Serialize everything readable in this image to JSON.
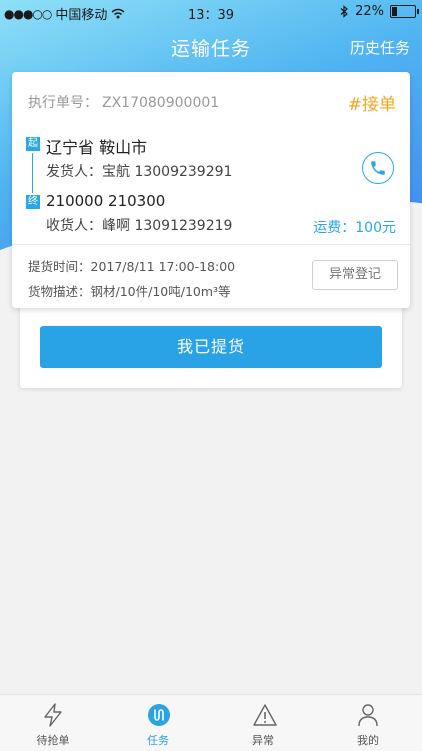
{
  "status_bar": {
    "signal_dots": "●●●○○",
    "carrier": "中国移动",
    "time": "13：39",
    "battery_percent": 22,
    "battery_label": "22%"
  },
  "nav": {
    "title": "运输任务",
    "history_label": "历史任务"
  },
  "task_card": {
    "exec_label": "执行单号：",
    "exec_number": "ZX17080900001",
    "status_tag": "#接单",
    "origin_badge": "起",
    "origin": "辽宁省  鞍山市",
    "sender": "发货人：宝航 13009239291",
    "dest_badge": "终",
    "dest": "210000    210300",
    "receiver": "收货人：峰啊 13091239219",
    "fee": "运费：100元",
    "pickup_time": "提货时间：2017/8/11  17:00-18:00",
    "goods_desc": "货物描述：钢材/10件/10吨/10m³等",
    "abnormal_button": "异常登记"
  },
  "actions": {
    "picked_up_button": "我已提货"
  },
  "tabbar": {
    "active_color": "#2aa2e6",
    "items": [
      {
        "label": "待抢单",
        "icon": "lightning-icon"
      },
      {
        "label": "任务",
        "icon": "route-icon"
      },
      {
        "label": "异常",
        "icon": "warning-icon"
      },
      {
        "label": "我的",
        "icon": "person-icon"
      }
    ]
  }
}
